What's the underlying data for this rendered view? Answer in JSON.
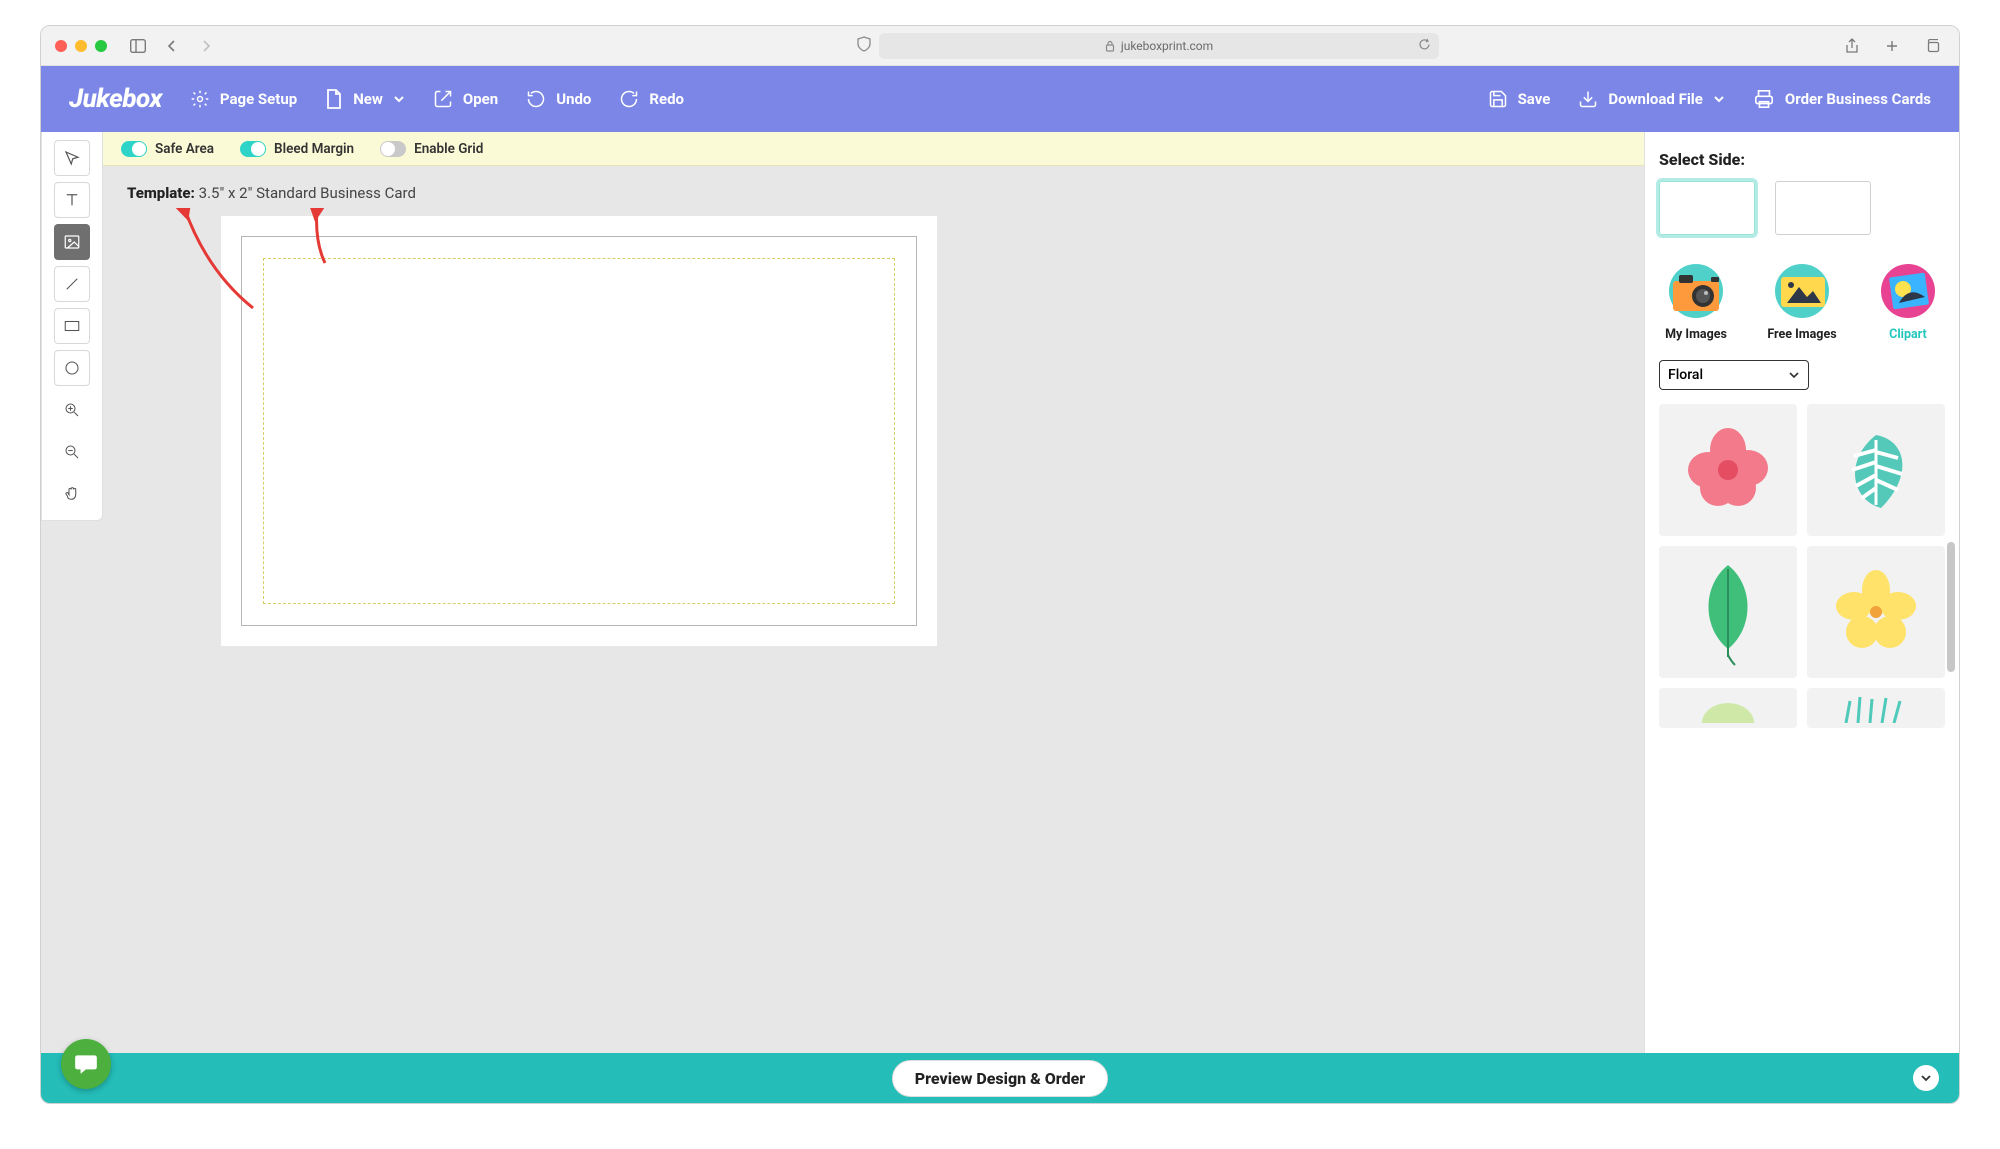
{
  "browser": {
    "url": "jukeboxprint.com"
  },
  "header": {
    "logo": "Jukebox",
    "page_setup": "Page Setup",
    "new": "New",
    "open": "Open",
    "undo": "Undo",
    "redo": "Redo",
    "save": "Save",
    "download": "Download File",
    "order": "Order Business Cards"
  },
  "options": {
    "safe_area": {
      "label": "Safe Area",
      "on": true
    },
    "bleed_margin": {
      "label": "Bleed Margin",
      "on": true
    },
    "enable_grid": {
      "label": "Enable Grid",
      "on": false
    }
  },
  "template": {
    "prefix": "Template:",
    "name": "3.5\" x 2\" Standard Business Card"
  },
  "right_panel": {
    "select_side": "Select Side:",
    "tabs": {
      "my_images": "My Images",
      "free_images": "Free Images",
      "clipart": "Clipart"
    },
    "category": "Floral"
  },
  "bottom": {
    "preview": "Preview Design & Order"
  }
}
